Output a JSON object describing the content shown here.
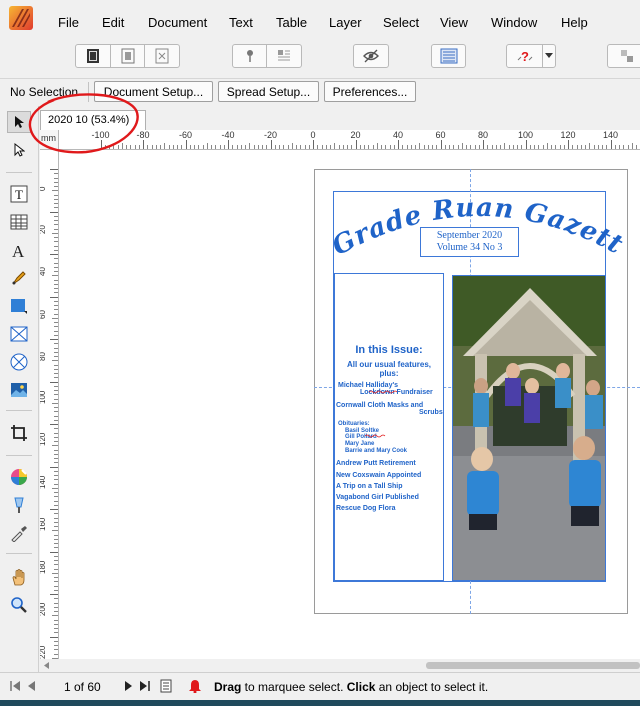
{
  "menu": {
    "items": [
      "File",
      "Edit",
      "Document",
      "Text",
      "Table",
      "Layer",
      "Select",
      "View",
      "Window",
      "Help"
    ]
  },
  "context_bar": {
    "selection_label": "No Selection",
    "buttons": [
      "Document Setup...",
      "Spread Setup...",
      "Preferences..."
    ]
  },
  "document": {
    "tab_label": "2020 10 (53.4%)",
    "annotation_color": "#e0191b"
  },
  "ruler": {
    "unit": "mm",
    "h_labels": [
      "-100",
      "-80",
      "-60",
      "-40",
      "-20",
      "0",
      "20",
      "40",
      "60",
      "80",
      "100",
      "120",
      "140"
    ],
    "v_labels": [
      "0",
      "20",
      "40",
      "60",
      "80",
      "100",
      "120",
      "140",
      "160",
      "180",
      "200",
      "220"
    ]
  },
  "page": {
    "masthead": "Grade Ruan Gazette",
    "date_line": "September 2020",
    "volume_line": "Volume 34 No 3",
    "issue_heading": "In this Issue:",
    "issue_subheading": "All our usual features, plus:",
    "items": [
      "Michael Halliday's",
      "Lockdown Fundraiser",
      "Cornwall Cloth Masks and",
      "Scrubs",
      "Obituaries:",
      "Basil Soltke",
      "Gill Pollard",
      "Mary Jane",
      "Barrie and Mary Cook",
      "Andrew Putt Retirement",
      "New Coxswain Appointed",
      "A Trip on a Tall Ship",
      "Vagabond Girl Published",
      "Rescue Dog Flora"
    ],
    "text_color": "#1f63c8"
  },
  "status": {
    "page_counter": "1 of 60",
    "hint_bold1": "Drag",
    "hint_text1": " to marquee select. ",
    "hint_bold2": "Click",
    "hint_text2": " an object to select it."
  }
}
